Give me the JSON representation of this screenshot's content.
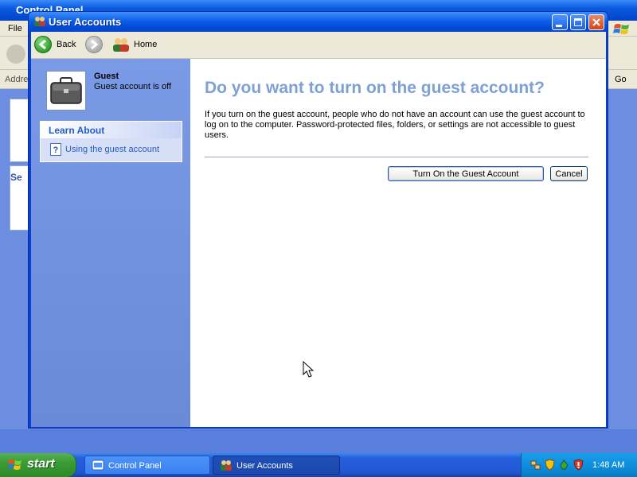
{
  "background_window": {
    "title": "Control Panel",
    "menu_file": "File",
    "address_label": "Address",
    "go_label": "Go",
    "panel_label": "Se"
  },
  "window": {
    "title": "User Accounts",
    "toolbar": {
      "back_label": "Back",
      "home_label": "Home"
    },
    "sidebar": {
      "user_name": "Guest",
      "user_status": "Guest account is off",
      "learn_about_title": "Learn About",
      "learn_about_items": [
        {
          "label": "Using the guest account"
        }
      ]
    },
    "main": {
      "heading": "Do you want to turn on the guest account?",
      "description": "If you turn on the guest account, people who do not have an account can use the guest account to log on to the computer. Password-protected files, folders, or settings are not accessible to guest users.",
      "primary_button": "Turn On the Guest Account",
      "cancel_button": "Cancel"
    }
  },
  "taskbar": {
    "start_label": "start",
    "tasks": [
      {
        "label": "Control Panel",
        "active": false
      },
      {
        "label": "User Accounts",
        "active": true
      }
    ],
    "clock": "1:48 AM"
  },
  "colors": {
    "heading": "#7ea0d6",
    "link": "#215dc6",
    "sidebar": "#7a9ae6",
    "titlebar": "#0c5fe8",
    "start_button": "#3b9b35"
  }
}
